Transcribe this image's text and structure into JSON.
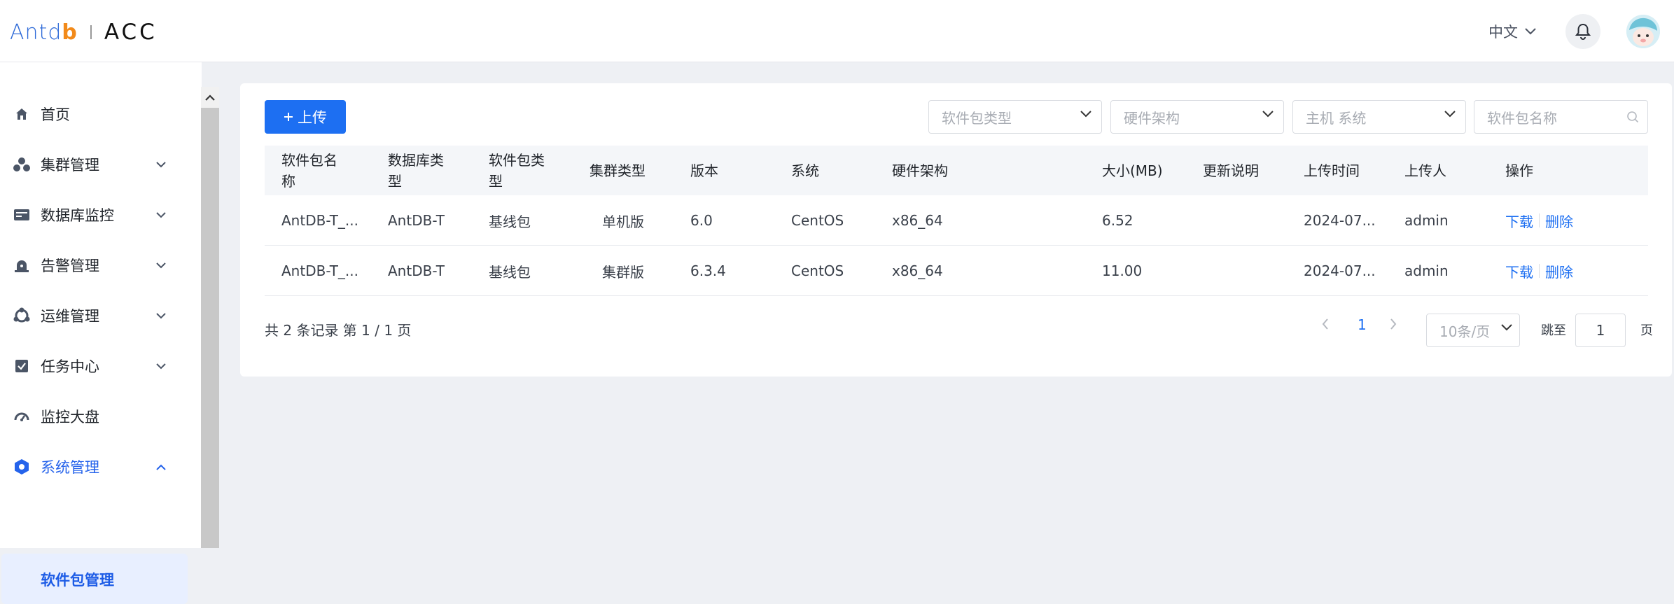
{
  "header": {
    "logo_text": "Antdb",
    "logo_product": "ACC",
    "language": "中文"
  },
  "sidebar": {
    "items": [
      {
        "label": "首页",
        "icon": "home-icon",
        "expandable": false
      },
      {
        "label": "集群管理",
        "icon": "cluster-icon",
        "expandable": true
      },
      {
        "label": "数据库监控",
        "icon": "database-monitor-icon",
        "expandable": true
      },
      {
        "label": "告警管理",
        "icon": "alarm-icon",
        "expandable": true
      },
      {
        "label": "运维管理",
        "icon": "ops-icon",
        "expandable": true
      },
      {
        "label": "任务中心",
        "icon": "task-icon",
        "expandable": true
      },
      {
        "label": "监控大盘",
        "icon": "dashboard-icon",
        "expandable": false
      },
      {
        "label": "系统管理",
        "icon": "settings-icon",
        "expandable": true,
        "expanded": true
      }
    ],
    "subitem": "软件包管理"
  },
  "toolbar": {
    "upload_label": "上传",
    "filter_package_type": "软件包类型",
    "filter_arch": "硬件架构",
    "filter_os": "主机 系统",
    "search_placeholder": "软件包名称"
  },
  "table": {
    "columns": [
      "软件包名称",
      "数据库类型",
      "软件包类型",
      "集群类型",
      "版本",
      "系统",
      "硬件架构",
      "大小(MB)",
      "更新说明",
      "上传时间",
      "上传人",
      "操作"
    ],
    "rows": [
      {
        "name": "AntDB-T_...",
        "db_type": "AntDB-T",
        "pkg_type": "基线包",
        "cluster_type": "单机版",
        "version": "6.0",
        "os": "CentOS",
        "arch": "x86_64",
        "size": "6.52",
        "notes": "",
        "upload_time": "2024-07...",
        "uploader": "admin",
        "action_download": "下载",
        "action_delete": "删除"
      },
      {
        "name": "AntDB-T_...",
        "db_type": "AntDB-T",
        "pkg_type": "基线包",
        "cluster_type": "集群版",
        "version": "6.3.4",
        "os": "CentOS",
        "arch": "x86_64",
        "size": "11.00",
        "notes": "",
        "upload_time": "2024-07...",
        "uploader": "admin",
        "action_download": "下载",
        "action_delete": "删除"
      }
    ]
  },
  "pagination": {
    "summary": "共 2 条记录 第 1 / 1 页",
    "current_page": "1",
    "page_size": "10条/页",
    "jump_label": "跳至",
    "jump_value": "1",
    "jump_suffix": "页"
  },
  "colors": {
    "accent": "#1d6ff2",
    "active_nav_bg": "#e8efff"
  }
}
